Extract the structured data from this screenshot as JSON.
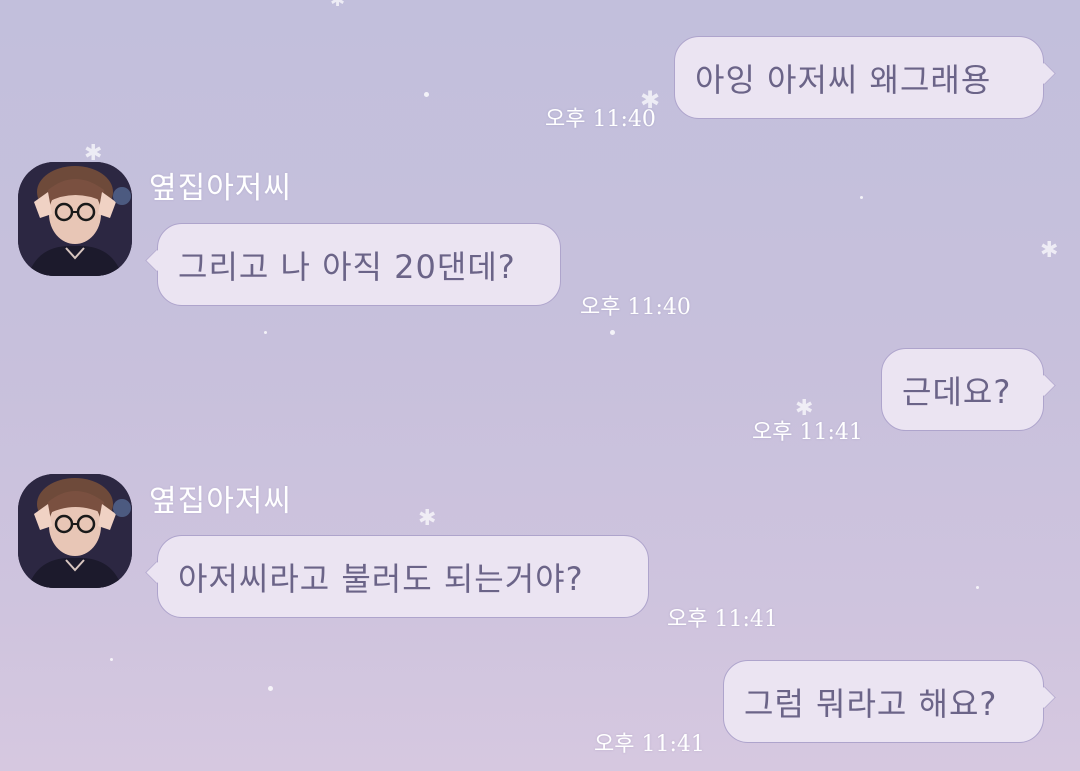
{
  "conversation": {
    "contact_name": "옆집아저씨",
    "messages": [
      {
        "direction": "out",
        "text": "아잉 아저씨 왜그래용",
        "time": "오후 11:40"
      },
      {
        "direction": "in",
        "sender": "옆집아저씨",
        "text": "그리고 나 아직 20댄데?",
        "time": "오후 11:40"
      },
      {
        "direction": "out",
        "text": "근데요?",
        "time": "오후 11:41"
      },
      {
        "direction": "in",
        "sender": "옆집아저씨",
        "text": "아저씨라고 불러도 되는거야?",
        "time": "오후 11:41"
      },
      {
        "direction": "out",
        "text": "그럼 뭐라고 해요?",
        "time": "오후 11:41"
      }
    ]
  },
  "colors": {
    "bubble_fill": "#ebe4f2",
    "bubble_border": "#aea4cc",
    "bubble_text": "#6b6488",
    "timestamp_text": "#ffffff",
    "background_top": "#c2bfdc",
    "background_bottom": "#d6c8e0"
  },
  "icons": {
    "avatar": "profile-photo",
    "decoration": "sparkle-star"
  }
}
